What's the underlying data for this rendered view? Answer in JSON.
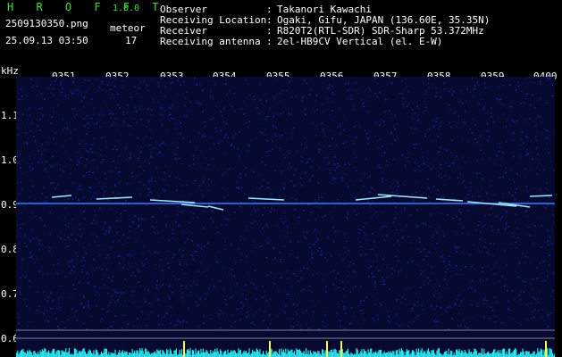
{
  "header": {
    "brand": "H R O F F T",
    "version": "1.0.0",
    "filename": "2509130350.png",
    "datetime": "25.09.13 03:50",
    "meteor_label": "meteor",
    "meteor_count": "17"
  },
  "info": {
    "rows": [
      {
        "label": "Observer",
        "sep": ":",
        "value": "Takanori Kawachi"
      },
      {
        "label": "Receiving Location",
        "sep": ":",
        "value": "Ogaki, Gifu, JAPAN (136.60E, 35.35N)"
      },
      {
        "label": "Receiver",
        "sep": ":",
        "value": "R820T2(RTL-SDR) SDR-Sharp 53.372MHz"
      },
      {
        "label": "Receiving antenna",
        "sep": ":",
        "value": "2el-HB9CV Vertical (el. E-W)"
      }
    ]
  },
  "axis": {
    "y_unit": "kHz",
    "y_ticks": [
      "1.1",
      "1.0",
      "0.9",
      "0.8",
      "0.7",
      "0.6"
    ],
    "x_ticks": [
      "0351",
      "0352",
      "0353",
      "0354",
      "0355",
      "0356",
      "0357",
      "0358",
      "0359",
      "0400"
    ]
  },
  "colors": {
    "background": "#000000",
    "plot_noise": "#0a0f4a",
    "carrier": "#3a7bff",
    "meteor": "#9fe6ff",
    "brand": "#3ce03c",
    "level_bar": "#2ee6f0",
    "level_peak": "#ffff40"
  }
}
